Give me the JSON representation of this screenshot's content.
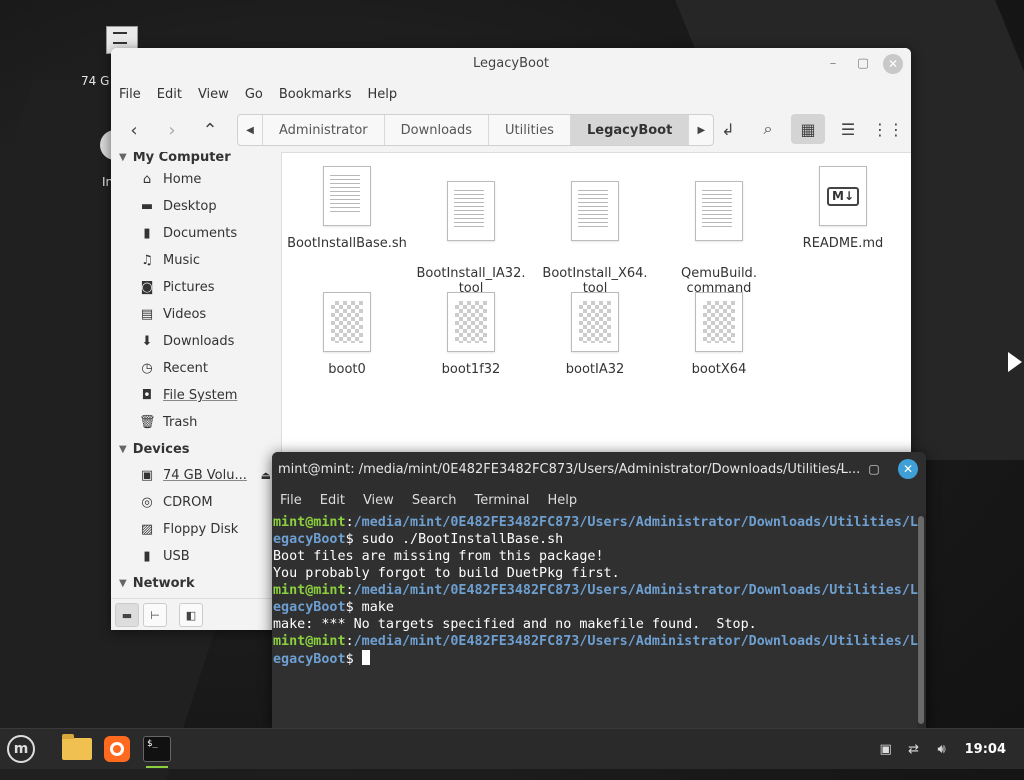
{
  "desktop": {
    "icon_label_1": "74 G",
    "icon_label_2": "In"
  },
  "file_manager": {
    "title": "LegacyBoot",
    "menu": [
      "File",
      "Edit",
      "View",
      "Go",
      "Bookmarks",
      "Help"
    ],
    "breadcrumbs": [
      "Administrator",
      "Downloads",
      "Utilities",
      "LegacyBoot"
    ],
    "sidebar": {
      "my_computer": {
        "heading": "My Computer",
        "items": [
          {
            "label": "Home",
            "icon": "home-icon"
          },
          {
            "label": "Desktop",
            "icon": "desktop-icon"
          },
          {
            "label": "Documents",
            "icon": "document-icon"
          },
          {
            "label": "Music",
            "icon": "music-icon"
          },
          {
            "label": "Pictures",
            "icon": "camera-icon"
          },
          {
            "label": "Videos",
            "icon": "film-icon"
          },
          {
            "label": "Downloads",
            "icon": "download-icon"
          },
          {
            "label": "Recent",
            "icon": "clock-icon"
          },
          {
            "label": "File System",
            "icon": "drive-icon"
          },
          {
            "label": "Trash",
            "icon": "trash-icon"
          }
        ]
      },
      "devices": {
        "heading": "Devices",
        "items": [
          {
            "label": "74 GB Volu...",
            "icon": "hard-disk-icon"
          },
          {
            "label": "CDROM",
            "icon": "disc-icon"
          },
          {
            "label": "Floppy Disk",
            "icon": "floppy-icon"
          },
          {
            "label": "USB",
            "icon": "usb-icon"
          }
        ]
      },
      "network": {
        "heading": "Network"
      }
    },
    "files": [
      {
        "name": "BootInstallBase.sh",
        "type": "text"
      },
      {
        "name": "BootInstall_IA32.\ntool",
        "type": "text"
      },
      {
        "name": "BootInstall_X64.\ntool",
        "type": "text"
      },
      {
        "name": "QemuBuild.\ncommand",
        "type": "text"
      },
      {
        "name": "README.md",
        "type": "markdown"
      },
      {
        "name": "boot0",
        "type": "binary"
      },
      {
        "name": "boot1f32",
        "type": "binary"
      },
      {
        "name": "bootIA32",
        "type": "binary"
      },
      {
        "name": "bootX64",
        "type": "binary"
      }
    ]
  },
  "terminal": {
    "title": "mint@mint: /media/mint/0E482FE3482FC873/Users/Administrator/Downloads/Utilities/L...",
    "menu": [
      "File",
      "Edit",
      "View",
      "Search",
      "Terminal",
      "Help"
    ],
    "user": "mint@mint",
    "lines": [
      {
        "kind": "prompt",
        "path": "/media/mint/0E482FE3482FC873/Users/Administrator/Downloads/Utilities/L",
        "path2": "egacyBoot",
        "cmd": "sudo ./BootInstallBase.sh"
      },
      {
        "kind": "out",
        "text": "Boot files are missing from this package!"
      },
      {
        "kind": "out",
        "text": "You probably forgot to build DuetPkg first."
      },
      {
        "kind": "prompt",
        "path": "/media/mint/0E482FE3482FC873/Users/Administrator/Downloads/Utilities/L",
        "path2": "egacyBoot",
        "cmd": "make"
      },
      {
        "kind": "out",
        "text": "make: *** No targets specified and no makefile found.  Stop."
      },
      {
        "kind": "prompt",
        "path": "/media/mint/0E482FE3482FC873/Users/Administrator/Downloads/Utilities/L",
        "path2": "egacyBoot",
        "cmd": ""
      }
    ]
  },
  "taskbar": {
    "clock": "19:04",
    "colors": {
      "accent": "#8bd13f",
      "prompt_path": "#6e9fd1"
    }
  }
}
